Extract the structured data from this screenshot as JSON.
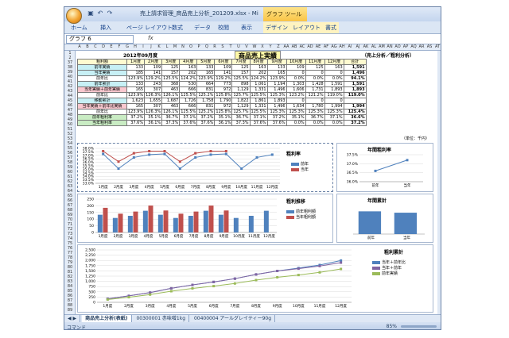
{
  "window": {
    "title": "売上請求管理_商品売上分析_201209.xlsx - Mi",
    "context_tab": "グラフ ツール"
  },
  "ribbon": {
    "tabs": [
      "ホーム",
      "挿入",
      "ページ レイアウト",
      "数式",
      "データ",
      "校閲",
      "表示",
      "デザイン",
      "レイアウト",
      "書式"
    ]
  },
  "formula_bar": {
    "name_box": "グラフ 6",
    "fx": "fx"
  },
  "columns": [
    "A",
    "B",
    "C",
    "D",
    "E",
    "F",
    "G",
    "H",
    "I",
    "J",
    "K",
    "L",
    "M",
    "N",
    "O",
    "P",
    "Q",
    "R",
    "S",
    "T",
    "U",
    "V",
    "W",
    "X",
    "Y",
    "Z",
    "AA",
    "AB",
    "AC",
    "AD",
    "AE",
    "AF",
    "AG",
    "AH",
    "AI",
    "AJ",
    "AK",
    "AL",
    "AM",
    "AN",
    "AO",
    "AP",
    "AQ",
    "AR",
    "AS",
    "AT",
    "AU",
    "AV"
  ],
  "row_numbers": [
    "1",
    "2",
    "37",
    "38",
    "39",
    "40",
    "41",
    "42",
    "43",
    "44",
    "45",
    "46",
    "47",
    "48",
    "49",
    "50",
    "51",
    "52",
    "53",
    "54",
    "55",
    "56",
    "57",
    "58",
    "59",
    "60",
    "61",
    "62",
    "63",
    "64",
    "65",
    "66",
    "67",
    "68",
    "69",
    "70",
    "71",
    "72",
    "73",
    "74",
    "75",
    "76",
    "77",
    "78",
    "79",
    "80",
    "81",
    "82",
    "83",
    "84",
    "85",
    "86",
    "87",
    "88",
    "89"
  ],
  "report": {
    "period": "2012年09月度",
    "title": "商品売上実績",
    "subtitle": "（売上分析／粗利分析）",
    "unit_note": "（単位：千円）",
    "headers": [
      "粗利額",
      "1月度",
      "2月度",
      "3月度",
      "4月度",
      "5月度",
      "6月度",
      "7月度",
      "8月度",
      "9月度",
      "10月度",
      "11月度",
      "12月度",
      "合計"
    ],
    "rows": [
      {
        "label": "前年実績",
        "values": [
          "133",
          "109",
          "125",
          "163",
          "133",
          "109",
          "125",
          "163",
          "133",
          "109",
          "125",
          "163",
          "1,591"
        ],
        "cls": "cyan"
      },
      {
        "label": "当年実績",
        "values": [
          "185",
          "141",
          "157",
          "202",
          "165",
          "141",
          "157",
          "202",
          "165",
          "0",
          "0",
          "0",
          "1,496"
        ],
        "cls": "cyan"
      },
      {
        "label": "前年比",
        "values": [
          "123.9%",
          "129.2%",
          "125.5%",
          "124.2%",
          "123.9%",
          "129.2%",
          "125.5%",
          "124.2%",
          "123.9%",
          "0.0%",
          "0.0%",
          "0.0%",
          "94.1%"
        ],
        "cls": ""
      },
      {
        "label": "前年累計",
        "values": [
          "133",
          "243",
          "368",
          "530",
          "664",
          "773",
          "898",
          "1,061",
          "1,194",
          "1,303",
          "1,428",
          "1,591",
          "1,591"
        ],
        "cls": "cyan"
      },
      {
        "label": "当年実績＋前年実績",
        "values": [
          "165",
          "307",
          "463",
          "666",
          "831",
          "972",
          "1,129",
          "1,331",
          "1,496",
          "1,606",
          "1,731",
          "1,893",
          "1,893"
        ],
        "cls": "pink"
      },
      {
        "label": "前年比",
        "values": [
          "123.9%",
          "126.3%",
          "126.1%",
          "125.5%",
          "125.2%",
          "125.8%",
          "125.7%",
          "125.5%",
          "125.3%",
          "123.2%",
          "121.2%",
          "119.0%",
          "119.0%"
        ],
        "cls": ""
      },
      {
        "label": "移動累計",
        "values": [
          "1,623",
          "1,655",
          "1,687",
          "1,726",
          "1,758",
          "1,790",
          "1,822",
          "1,861",
          "1,893",
          "0",
          "0",
          "0",
          ""
        ],
        "cls": "cyan"
      },
      {
        "label": "当年実績＋前年比実績",
        "values": [
          "165",
          "307",
          "463",
          "666",
          "831",
          "972",
          "1,129",
          "1,331",
          "1,496",
          "1,634",
          "1,780",
          "1,994",
          "1,994"
        ],
        "cls": "pink"
      },
      {
        "label": "前年比",
        "values": [
          "123.9%",
          "126.3%",
          "126.1%",
          "125.5%",
          "125.2%",
          "125.8%",
          "125.7%",
          "125.5%",
          "125.3%",
          "125.3%",
          "125.3%",
          "125.3%",
          "125.4%"
        ],
        "cls": ""
      },
      {
        "label": "前年粗利率",
        "values": [
          "37.2%",
          "35.1%",
          "36.7%",
          "37.1%",
          "37.2%",
          "35.1%",
          "36.7%",
          "37.1%",
          "37.2%",
          "35.1%",
          "36.7%",
          "37.1%",
          "36.6%"
        ],
        "cls": "green"
      },
      {
        "label": "当年粗利率",
        "values": [
          "37.6%",
          "36.1%",
          "37.3%",
          "37.6%",
          "37.6%",
          "36.1%",
          "37.3%",
          "37.6%",
          "37.6%",
          "0.0%",
          "0.0%",
          "0.0%",
          "37.2%"
        ],
        "cls": "green"
      }
    ]
  },
  "chart_data": [
    {
      "type": "line",
      "categories": [
        "1月度",
        "2月度",
        "3月度",
        "4月度",
        "5月度",
        "6月度",
        "7月度",
        "8月度",
        "9月度",
        "10月度",
        "11月度",
        "12月度"
      ],
      "title": "粗利率",
      "series": [
        {
          "name": "前年",
          "values": [
            37.2,
            35.1,
            36.7,
            37.1,
            37.2,
            35.1,
            36.7,
            37.1,
            37.2,
            35.1,
            36.7,
            37.1
          ],
          "color": "#4f81bd"
        },
        {
          "name": "当年",
          "values": [
            37.6,
            36.1,
            37.3,
            37.6,
            37.6,
            36.1,
            37.3,
            37.6,
            37.6,
            null,
            null,
            null
          ],
          "color": "#c0504d"
        }
      ],
      "yticks": [
        "38.0%",
        "37.5%",
        "37.0%",
        "36.5%",
        "36.0%",
        "35.5%",
        "35.0%",
        "34.5%",
        "34.0%",
        "33.5%",
        "33.0%"
      ],
      "ylim": [
        33.0,
        38.0
      ]
    },
    {
      "type": "line",
      "categories": [
        "前年",
        "当年"
      ],
      "title": "年間粗利率",
      "series": [
        {
          "name": "",
          "values": [
            36.6,
            37.2
          ],
          "color": "#4f81bd"
        }
      ],
      "yticks": [
        "37.5%",
        "37.0%",
        "36.5%",
        "36.0%"
      ],
      "ylim": [
        36.0,
        37.5
      ]
    },
    {
      "type": "bar",
      "categories": [
        "1月度",
        "2月度",
        "3月度",
        "4月度",
        "5月度",
        "6月度",
        "7月度",
        "8月度",
        "9月度",
        "10月度",
        "11月度",
        "12月度"
      ],
      "title": "粗利推移",
      "series": [
        {
          "name": "前年粗利額",
          "values": [
            133,
            109,
            125,
            163,
            133,
            109,
            125,
            163,
            133,
            109,
            125,
            163
          ],
          "color": "#4f81bd"
        },
        {
          "name": "当年粗利額",
          "values": [
            185,
            141,
            157,
            202,
            165,
            141,
            157,
            202,
            165,
            0,
            0,
            0
          ],
          "color": "#c0504d"
        }
      ],
      "yticks": [
        "250",
        "200",
        "150",
        "100",
        "50",
        "0"
      ],
      "ylim": [
        0,
        250
      ]
    },
    {
      "type": "bar",
      "categories": [
        "前年",
        "当年"
      ],
      "title": "年間累計",
      "series": [
        {
          "name": "",
          "values": [
            1591,
            1496
          ],
          "color": "#4f81bd"
        }
      ],
      "ylim": [
        0,
        2000
      ]
    },
    {
      "type": "line",
      "categories": [
        "1月度",
        "2月度",
        "3月度",
        "4月度",
        "5月度",
        "6月度",
        "7月度",
        "8月度",
        "9月度",
        "10月度",
        "11月度",
        "12月度"
      ],
      "title": "粗利累計",
      "series": [
        {
          "name": "当年＋前年比",
          "values": [
            165,
            307,
            463,
            666,
            831,
            972,
            1129,
            1331,
            1496,
            1634,
            1780,
            1994
          ],
          "color": "#4f81bd"
        },
        {
          "name": "当年＋前年",
          "values": [
            165,
            307,
            463,
            666,
            831,
            972,
            1129,
            1331,
            1496,
            1606,
            1731,
            1893
          ],
          "color": "#8064a2"
        },
        {
          "name": "前年実績",
          "values": [
            133,
            243,
            368,
            530,
            664,
            773,
            898,
            1061,
            1194,
            1303,
            1428,
            1591
          ],
          "color": "#9bbb59"
        }
      ],
      "yticks": [
        "2,500",
        "2,250",
        "2,000",
        "1,750",
        "1,500",
        "1,250",
        "1,000",
        "750",
        "500",
        "250",
        "0"
      ],
      "ylim": [
        0,
        2500
      ]
    }
  ],
  "sheet_tabs": [
    "商品売上分析(表紙)",
    "00300001 赤味噌1kg",
    "00400004 アールグレイティー90g"
  ],
  "status": {
    "mode": "コマンド",
    "zoom": "85%"
  }
}
